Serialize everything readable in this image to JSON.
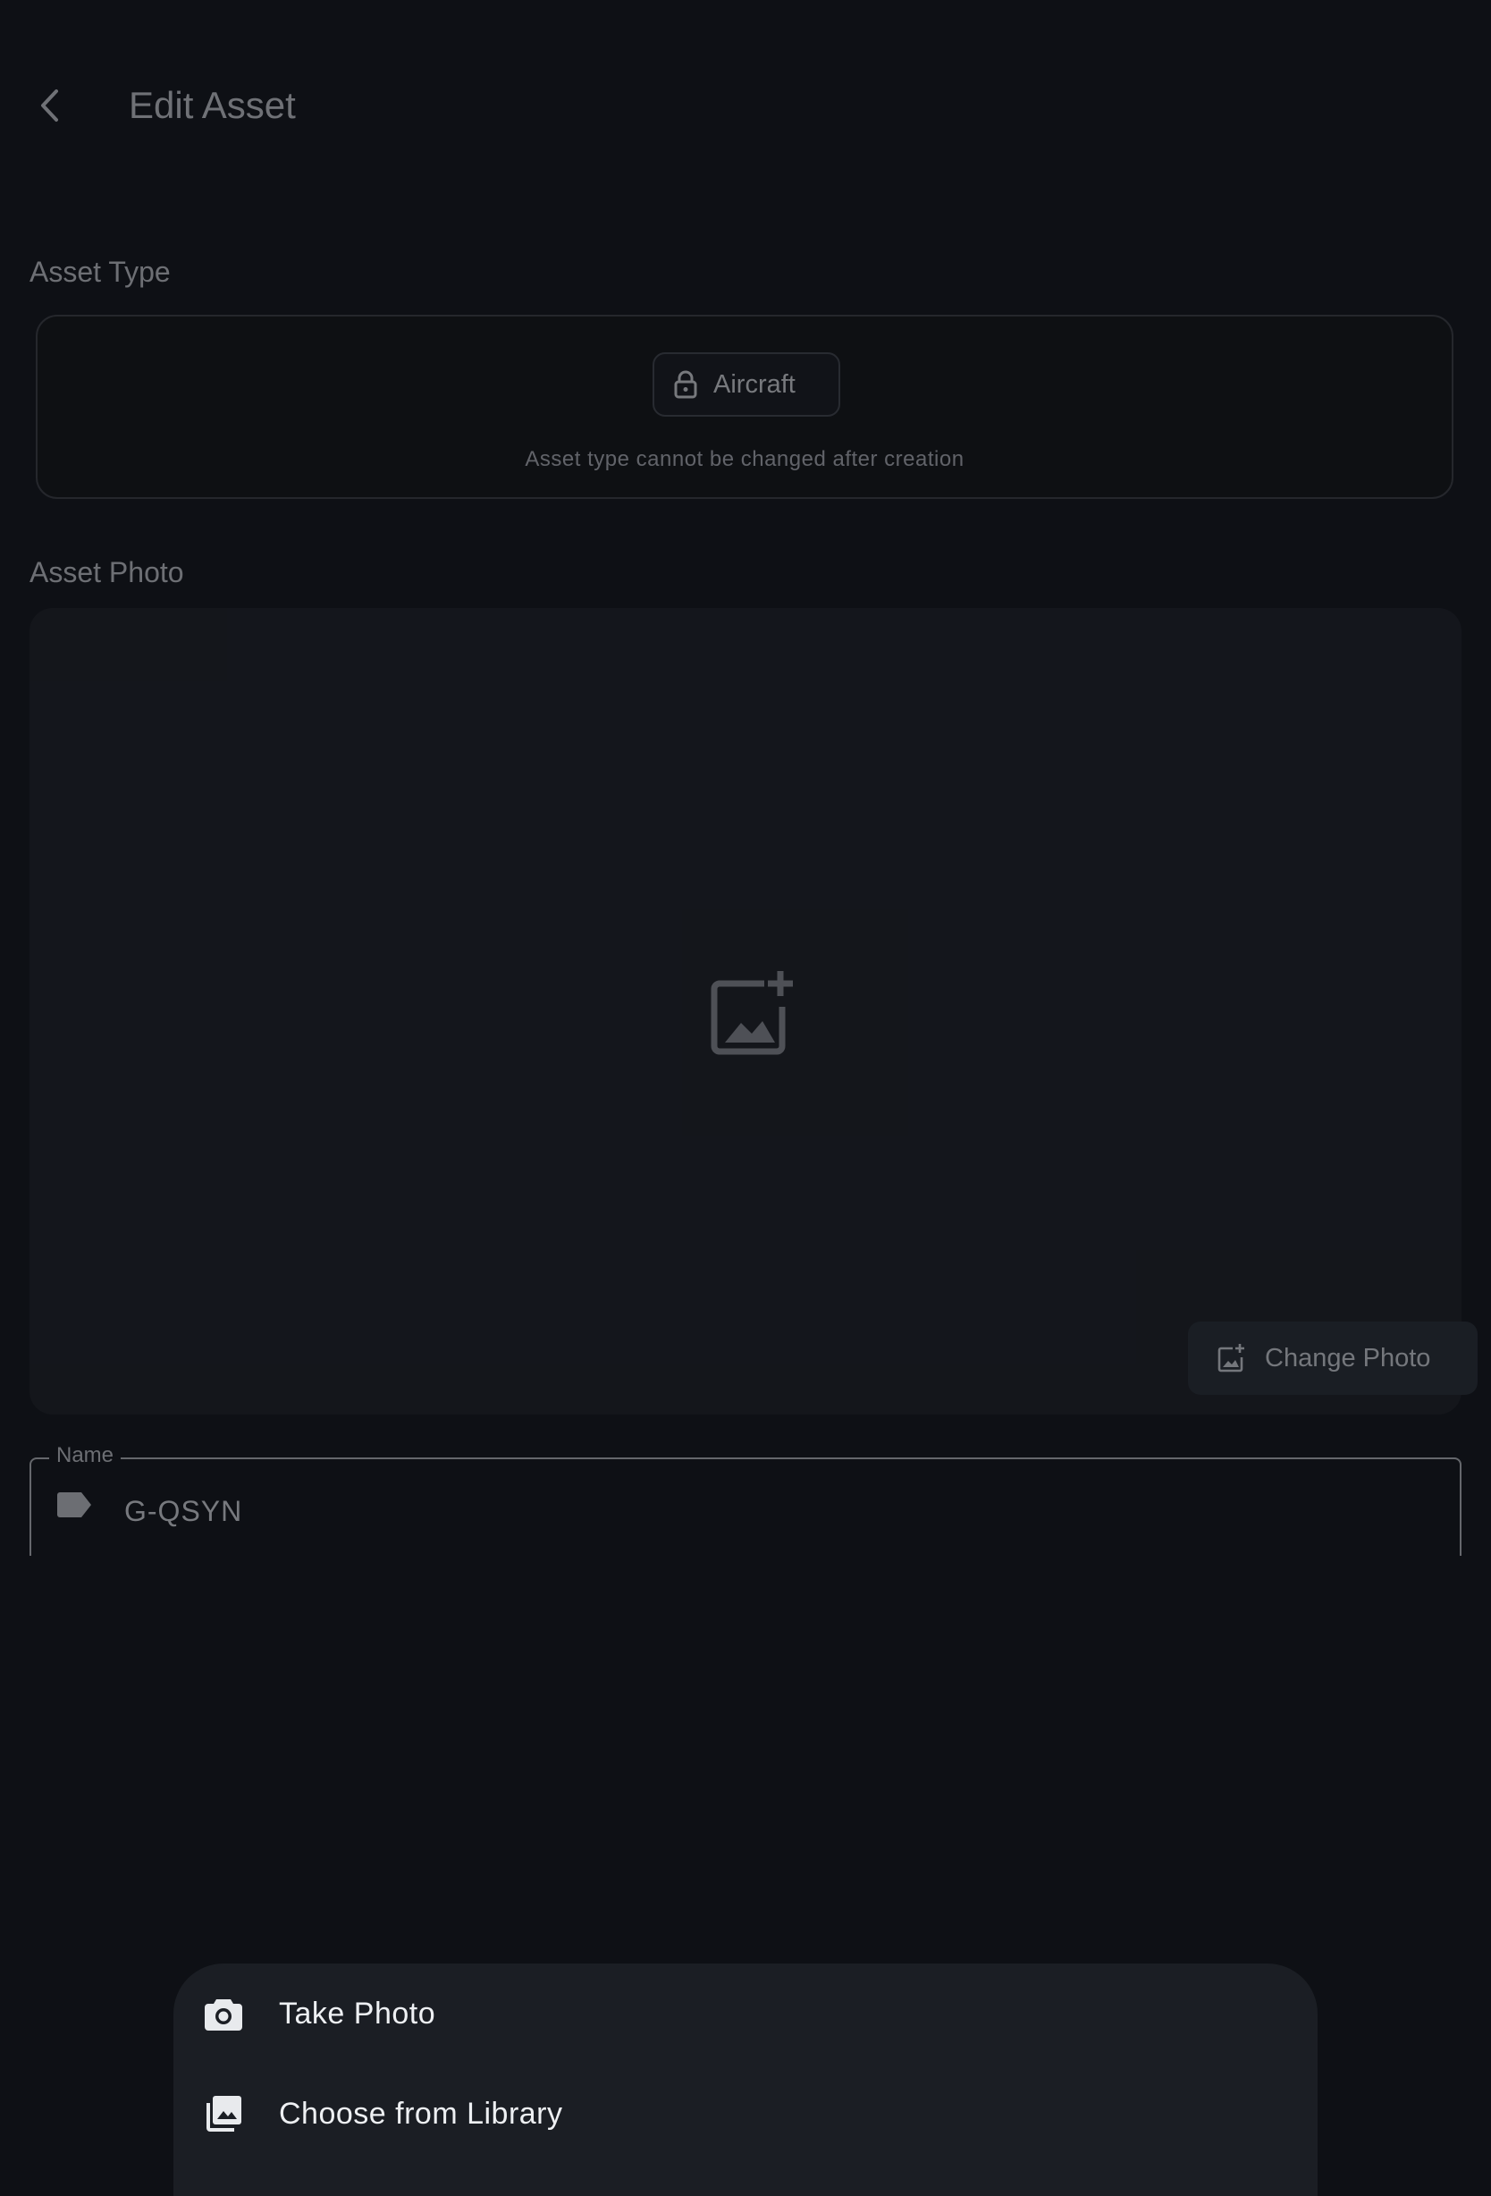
{
  "header": {
    "title": "Edit Asset",
    "back_icon": "chevron-left-icon"
  },
  "asset_type": {
    "label": "Asset Type",
    "value": "Aircraft",
    "lock_icon": "lock-icon",
    "note": "Asset type cannot be changed after creation"
  },
  "asset_photo": {
    "label": "Asset Photo",
    "placeholder_icon": "add-photo-icon",
    "change_button": "Change Photo"
  },
  "name_field": {
    "label": "Name",
    "value": "G-QSYN",
    "icon": "label-tag-icon"
  },
  "sheet": {
    "items": [
      {
        "label": "Take Photo",
        "icon": "camera-icon"
      },
      {
        "label": "Choose from Library",
        "icon": "photo-library-icon"
      }
    ]
  },
  "colors": {
    "background": "#0e1015",
    "surface": "#1b1d22",
    "sheet": "#1b1e24"
  }
}
